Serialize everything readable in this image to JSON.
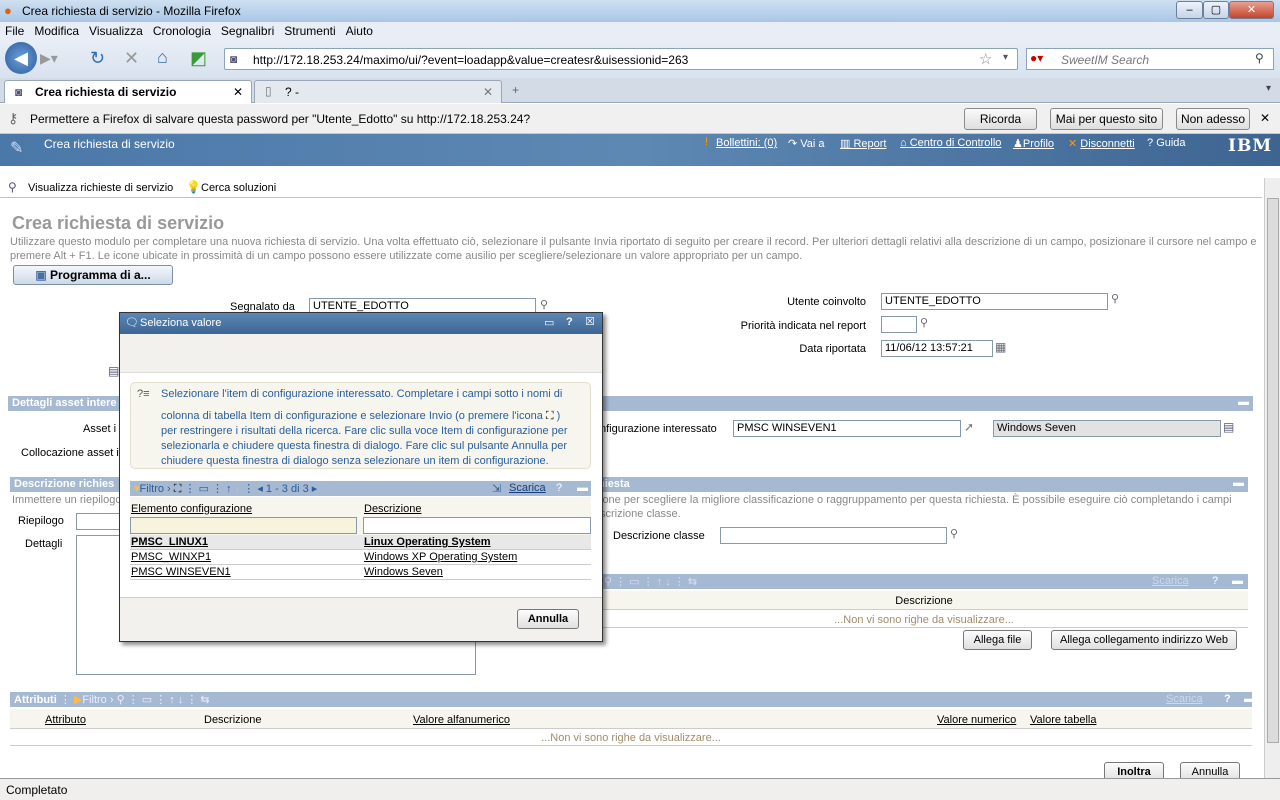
{
  "window": {
    "title": "Crea richiesta di servizio - Mozilla Firefox",
    "min": "–",
    "max": "▢",
    "close": "✕"
  },
  "menu": [
    "File",
    "Modifica",
    "Visualizza",
    "Cronologia",
    "Segnalibri",
    "Strumenti",
    "Aiuto"
  ],
  "nav": {
    "url": "http://172.18.253.24/maximo/ui/?event=loadapp&value=createsr&uisessionid=263",
    "search_placeholder": "SweetIM Search"
  },
  "tabs": [
    {
      "label": "Crea richiesta di servizio",
      "active": true
    },
    {
      "label": "? -",
      "active": false
    }
  ],
  "new_tab": "+",
  "password_bar": {
    "text": "Permettere a Firefox di salvare questa password per \"Utente_Edotto\" su http://172.18.253.24?",
    "remember": "Ricorda",
    "never": "Mai per questo sito",
    "not_now": "Non adesso"
  },
  "app": {
    "title": "Crea richiesta di servizio",
    "links": [
      "Bollettini: (0)",
      "Vai a",
      "Report",
      "Centro di Controllo",
      "Profilo",
      "Disconnetti",
      "Guida"
    ],
    "logo": "IBM"
  },
  "toolbar": {
    "view": "Visualizza richieste di servizio",
    "search": "Cerca soluzioni"
  },
  "page": {
    "title": "Crea richiesta di servizio",
    "desc1": "Utilizzare questo modulo per completare una nuova richiesta di servizio. Una volta effettuato ciò, selezionare il pulsante Invia riportato di seguito per creare il record. Per ulteriori dettagli relativi alla descrizione di un campo, posizionare il cursore nel campo e",
    "desc2": "premere Alt + F1. Le icone ubicate in prossimità di un campo possono essere utilizzate come ausilio per scegliere/selezionare un valore appropriato per un campo.",
    "schedule_btn": "Programma di a..."
  },
  "fields": {
    "reported_by_label": "Segnalato da",
    "reported_by": "UTENTE_EDOTTO",
    "affected_user_label": "Utente coinvolto",
    "affected_user": "UTENTE_EDOTTO",
    "priority_label": "Priorità indicata nel report",
    "priority": "",
    "date_label": "Data riportata",
    "date": "11/06/12 13:57:21"
  },
  "asset": {
    "section": "Dettagli asset intere",
    "asset_label": "Asset i",
    "location_label": "Collocazione asset i",
    "ci_label": "nfigurazione interessato",
    "ci": "PMSC WINSEVEN1",
    "ci_desc": "Windows Seven"
  },
  "description": {
    "section_left": "Descrizione richies",
    "section_right": "hiesta",
    "text_left": "Immettere un riepilogo",
    "text_right1": "ione per scegliere la migliore classificazione o raggruppamento per questa richiesta. È possibile eseguire ciò completando i campi",
    "text_right2": "scrizione classe.",
    "summary_label": "Riepilogo",
    "details_label": "Dettagli",
    "class_label": "Descrizione classe",
    "class_value": ""
  },
  "attachments": {
    "col": "Descrizione",
    "empty": "...Non vi sono righe da visualizzare...",
    "download": "Scarica",
    "help": "?",
    "attach_file": "Allega file",
    "attach_url": "Allega collegamento indirizzo Web"
  },
  "attributes": {
    "title": "Attributi",
    "filter": "Filtro",
    "download": "Scarica",
    "help": "?",
    "cols": [
      "Attributo",
      "Descrizione",
      "Valore alfanumerico",
      "Valore numerico",
      "Valore tabella"
    ],
    "empty": "...Non vi sono righe da visualizzare..."
  },
  "footer": {
    "submit": "Inoltra",
    "cancel": "Annulla"
  },
  "status": "Completato",
  "dialog": {
    "title": "Seleziona valore",
    "help": "?",
    "info": [
      "Selezionare l'item di configurazione interessato. Completare i campi sotto i nomi di",
      "colonna di tabella Item di configurazione e selezionare Invio (o premere l'icona",
      ")",
      "per restringere i risultati della ricerca. Fare clic sulla voce Item di configurazione per",
      "selezionarla e chiudere questa finestra di dialogo. Fare clic sul pulsante Annulla per",
      "chiudere questa finestra di dialogo senza selezionare un item di configurazione."
    ],
    "filter": "Filtro",
    "paging": "1 - 3 di 3",
    "download": "Scarica",
    "qhelp": "?",
    "cols": [
      "Elemento configurazione",
      "Descrizione"
    ],
    "rows": [
      {
        "ci": "PMSC_LINUX1",
        "desc": "Linux Operating System"
      },
      {
        "ci": "PMSC_WINXP1",
        "desc": "Windows XP Operating System"
      },
      {
        "ci": "PMSC WINSEVEN1",
        "desc": "Windows Seven"
      }
    ],
    "cancel": "Annulla"
  }
}
